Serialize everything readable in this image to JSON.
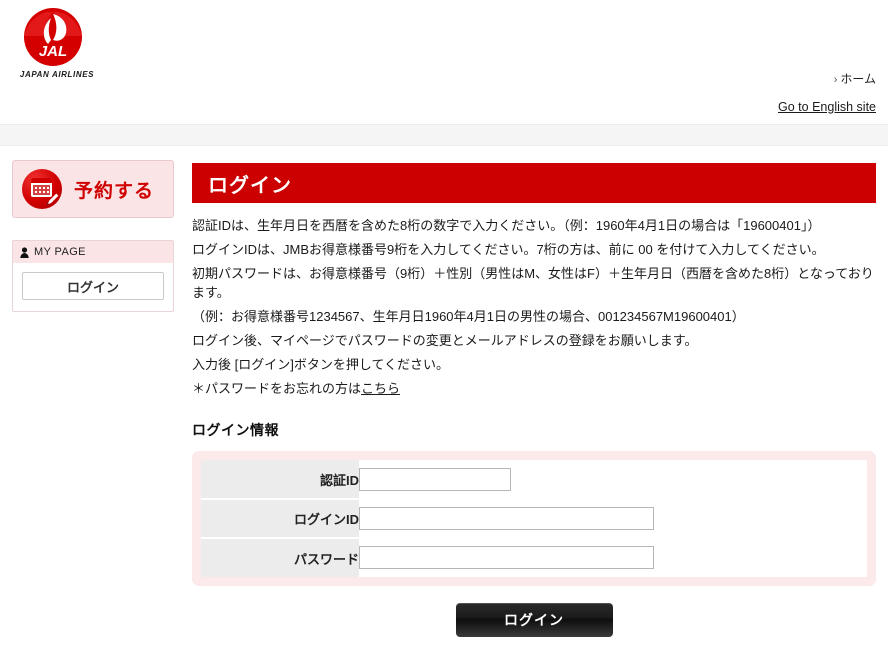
{
  "brand": {
    "logo_alt": "jal-tsurumaru-logo",
    "caption": "JAPAN AIRLINES",
    "red": "#cc0000"
  },
  "header": {
    "home_chevron": "›",
    "home_label": "ホーム",
    "english_site_label": "Go to English site"
  },
  "sidebar": {
    "reserve_button_label": "予約する",
    "mypage_heading": "MY PAGE",
    "login_button_label": "ログイン"
  },
  "main": {
    "page_title": "ログイン",
    "intro_lines": [
      "認証IDは、生年月日を西暦を含めた8桁の数字で入力ください。（例：1960年4月1日の場合は「19600401」）",
      "ログインIDは、JMBお得意様番号9桁を入力してください。7桁の方は、前に 00 を付けて入力してください。",
      "初期パスワードは、お得意様番号（9桁）＋性別（男性はM、女性はF）＋生年月日（西暦を含めた8桁）となっております。",
      "（例：お得意様番号1234567、生年月日1960年4月1日の男性の場合、001234567M19600401）",
      "ログイン後、マイページでパスワードの変更とメールアドレスの登録をお願いします。",
      "入力後 [ログイン]ボタンを押してください。"
    ],
    "forgot_prefix": "＊パスワードをお忘れの方は",
    "forgot_link_label": "こちら",
    "section_title": "ログイン情報",
    "form_rows": [
      {
        "label": "認証ID",
        "value": "",
        "placeholder": "",
        "width": "narrow"
      },
      {
        "label": "ログインID",
        "value": "",
        "placeholder": "",
        "width": "wide"
      },
      {
        "label": "パスワード",
        "value": "",
        "placeholder": "",
        "width": "wide"
      }
    ],
    "submit_label": "ログイン"
  }
}
